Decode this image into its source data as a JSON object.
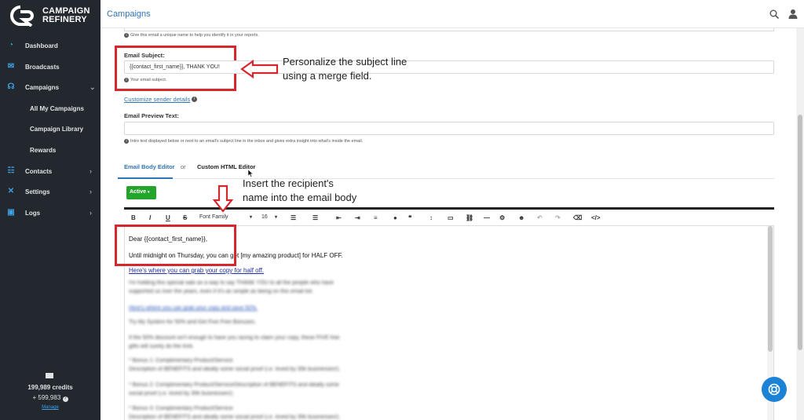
{
  "brand": {
    "line1": "CAMPAIGN",
    "line2": "REFINERY"
  },
  "sidebar": {
    "items": [
      {
        "label": "Dashboard",
        "icon": "dashboard-icon",
        "chevron": false
      },
      {
        "label": "Broadcasts",
        "icon": "broadcast-icon",
        "chevron": false
      },
      {
        "label": "Campaigns",
        "icon": "campaigns-icon",
        "chevron": true
      },
      {
        "label": "Contacts",
        "icon": "contacts-icon",
        "chevron": true
      },
      {
        "label": "Settings",
        "icon": "settings-icon",
        "chevron": true
      },
      {
        "label": "Logs",
        "icon": "logs-icon",
        "chevron": true
      }
    ],
    "subitems": [
      "All My Campaigns",
      "Campaign Library",
      "Rewards"
    ],
    "credits": "199,989 credits",
    "extra": "+ 599,983",
    "manage": "Manage"
  },
  "header": {
    "title": "Campaigns"
  },
  "form": {
    "unique_name_help": "Give this email a unique name to help you identify it in your reports.",
    "subject_label": "Email Subject:",
    "subject_value": "{{contact_first_name}}, THANK YOU!",
    "subject_help": "Your email subject.",
    "customize_link": "Customize sender details",
    "preview_label": "Email Preview Text:",
    "preview_value": "",
    "preview_help": "Intro text displayed below or next to an email's subject line in the inbox and gives extra insight into what's inside the email."
  },
  "tabs": {
    "body_editor": "Email Body Editor",
    "or": "or",
    "html_editor": "Custom HTML Editor"
  },
  "active_label": "Active",
  "toolbar": {
    "font_family": "Font Family",
    "font_size": "16"
  },
  "editor": {
    "greeting": "Dear {{contact_first_name}},",
    "line2": "Until midnight on Thursday, you can get [my amazing product] for HALF OFF.",
    "link": "Here's where you can grab your copy for half off.",
    "blurred": [
      "I'm holding this special sale as a way to say THANK YOU to all the people who have",
      "supported us over the years, even if it's as simple as being on this email list.",
      "Here's where you can grab your copy and save 50%.",
      "Try My System for 50% and Get Five Free Bonuses.",
      "If the 50% discount isn't enough to have you racing to claim your copy, these FIVE free",
      "gifts will surely do the trick.",
      "* Bonus 1: Complimentary Product/Service",
      "Description of BENEFITS and ideally some social proof (i.e. loved by 30k businesses!).",
      "* Bonus 2: Complimentary Product/Service/Description of BENEFITS and ideally some",
      "social proof (i.e. loved by 30k businesses!).",
      "* Bonus 3: Complimentary Product/Service",
      "Description of BENEFITS and ideally some social proof (i.e. loved by 30k businesses!)."
    ]
  },
  "annotations": {
    "subject_1": "Personalize the subject line",
    "subject_2": "using a merge field.",
    "body_1": "Insert the recipient's",
    "body_2": "name into the email body"
  },
  "colors": {
    "sidebar": "#22282e",
    "accent": "#2e74b7",
    "highlight": "#d6262e",
    "active": "#22a52a"
  }
}
